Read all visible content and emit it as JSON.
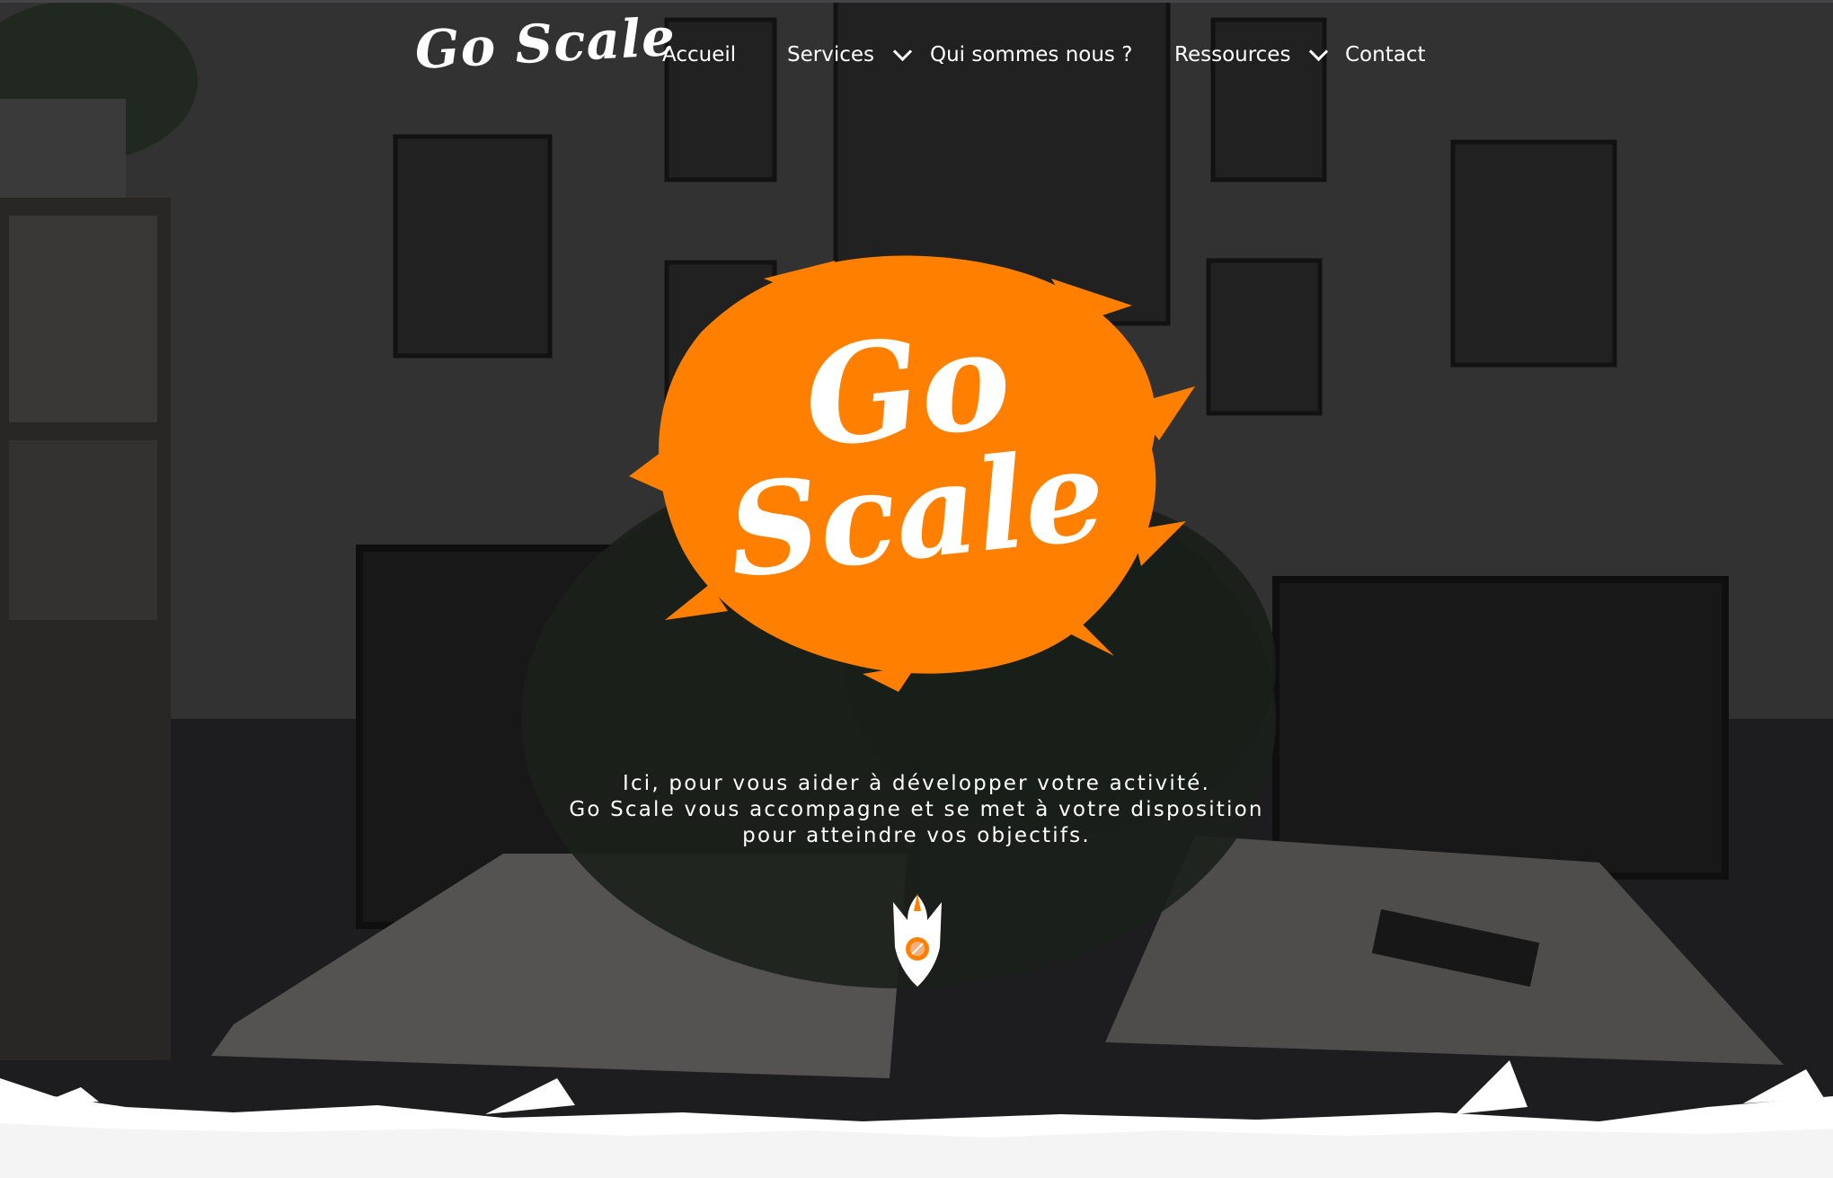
{
  "brand": {
    "name": "Go Scale",
    "logo_line1": "Go",
    "logo_line2": "Scale",
    "accent_color": "#ff8000"
  },
  "nav": {
    "items": [
      {
        "label": "Accueil",
        "has_dropdown": false
      },
      {
        "label": "Services",
        "has_dropdown": true
      },
      {
        "label": "Qui sommes nous ?",
        "has_dropdown": false
      },
      {
        "label": "Ressources",
        "has_dropdown": true
      },
      {
        "label": "Contact",
        "has_dropdown": false
      }
    ]
  },
  "hero": {
    "tagline": [
      "Ici, pour vous aider à développer votre activité.",
      "Go Scale vous accompagne et se met à votre disposition",
      "pour atteindre vos objectifs."
    ]
  },
  "icons": {
    "scroll": "rocket-icon",
    "dropdown": "chevron-down-icon"
  }
}
